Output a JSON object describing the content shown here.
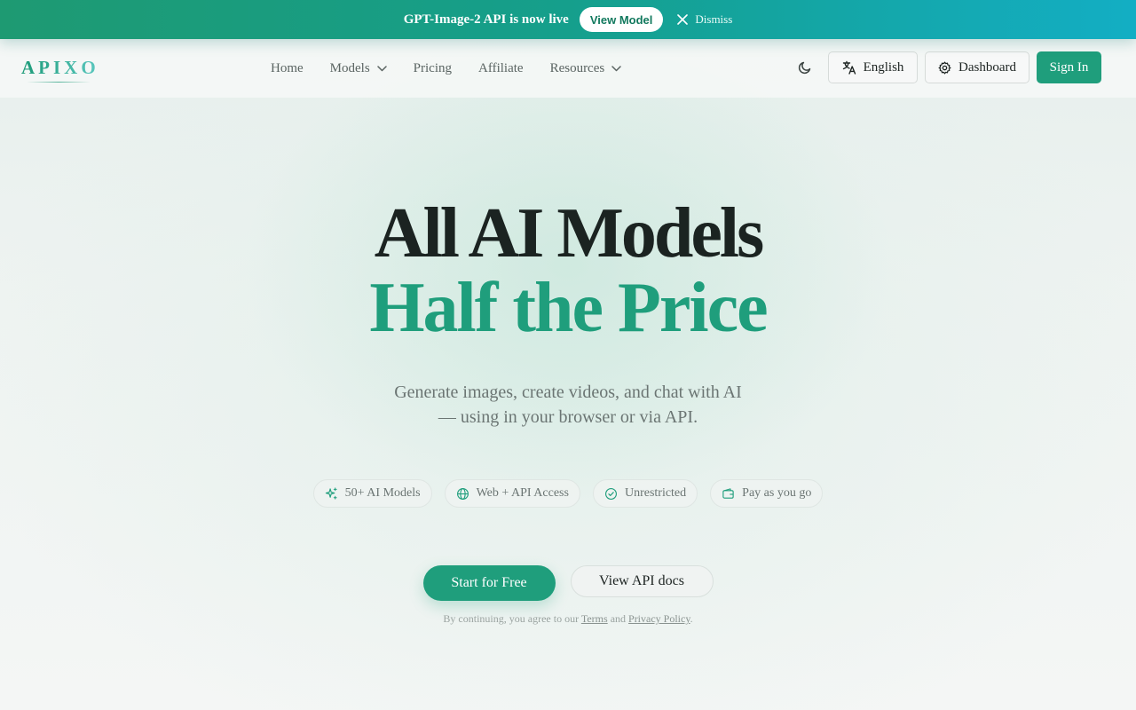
{
  "announcement": {
    "text": "GPT-Image-2 API is now live",
    "button_label": "View Model",
    "dismiss_label": "Dismiss"
  },
  "header": {
    "logo": "APIXO",
    "nav": [
      {
        "label": "Home",
        "dropdown": false
      },
      {
        "label": "Models",
        "dropdown": true
      },
      {
        "label": "Pricing",
        "dropdown": false
      },
      {
        "label": "Affiliate",
        "dropdown": false
      },
      {
        "label": "Resources",
        "dropdown": true
      }
    ],
    "theme_icon": "moon-icon",
    "language_label": "English",
    "dashboard_label": "Dashboard",
    "signin_label": "Sign In"
  },
  "hero": {
    "title_line1": "All AI Models",
    "title_line2": "Half the Price",
    "subtitle": "Generate images, create videos, and chat with AI — using in your browser or via API.",
    "features": [
      {
        "icon": "sparkles-icon",
        "label": "50+ AI Models"
      },
      {
        "icon": "globe-icon",
        "label": "Web + API Access"
      },
      {
        "icon": "check-circle-icon",
        "label": "Unrestricted"
      },
      {
        "icon": "wallet-icon",
        "label": "Pay as you go"
      }
    ],
    "primary_cta": "Start for Free",
    "secondary_cta": "View API docs",
    "legal": {
      "prefix": "By continuing, you agree to our",
      "terms": "Terms",
      "and": "and",
      "privacy": "Privacy Policy",
      "suffix": "."
    }
  },
  "colors": {
    "accent": "#1f9e7c",
    "banner_start": "#1e9a72",
    "banner_end": "#13aec4"
  }
}
